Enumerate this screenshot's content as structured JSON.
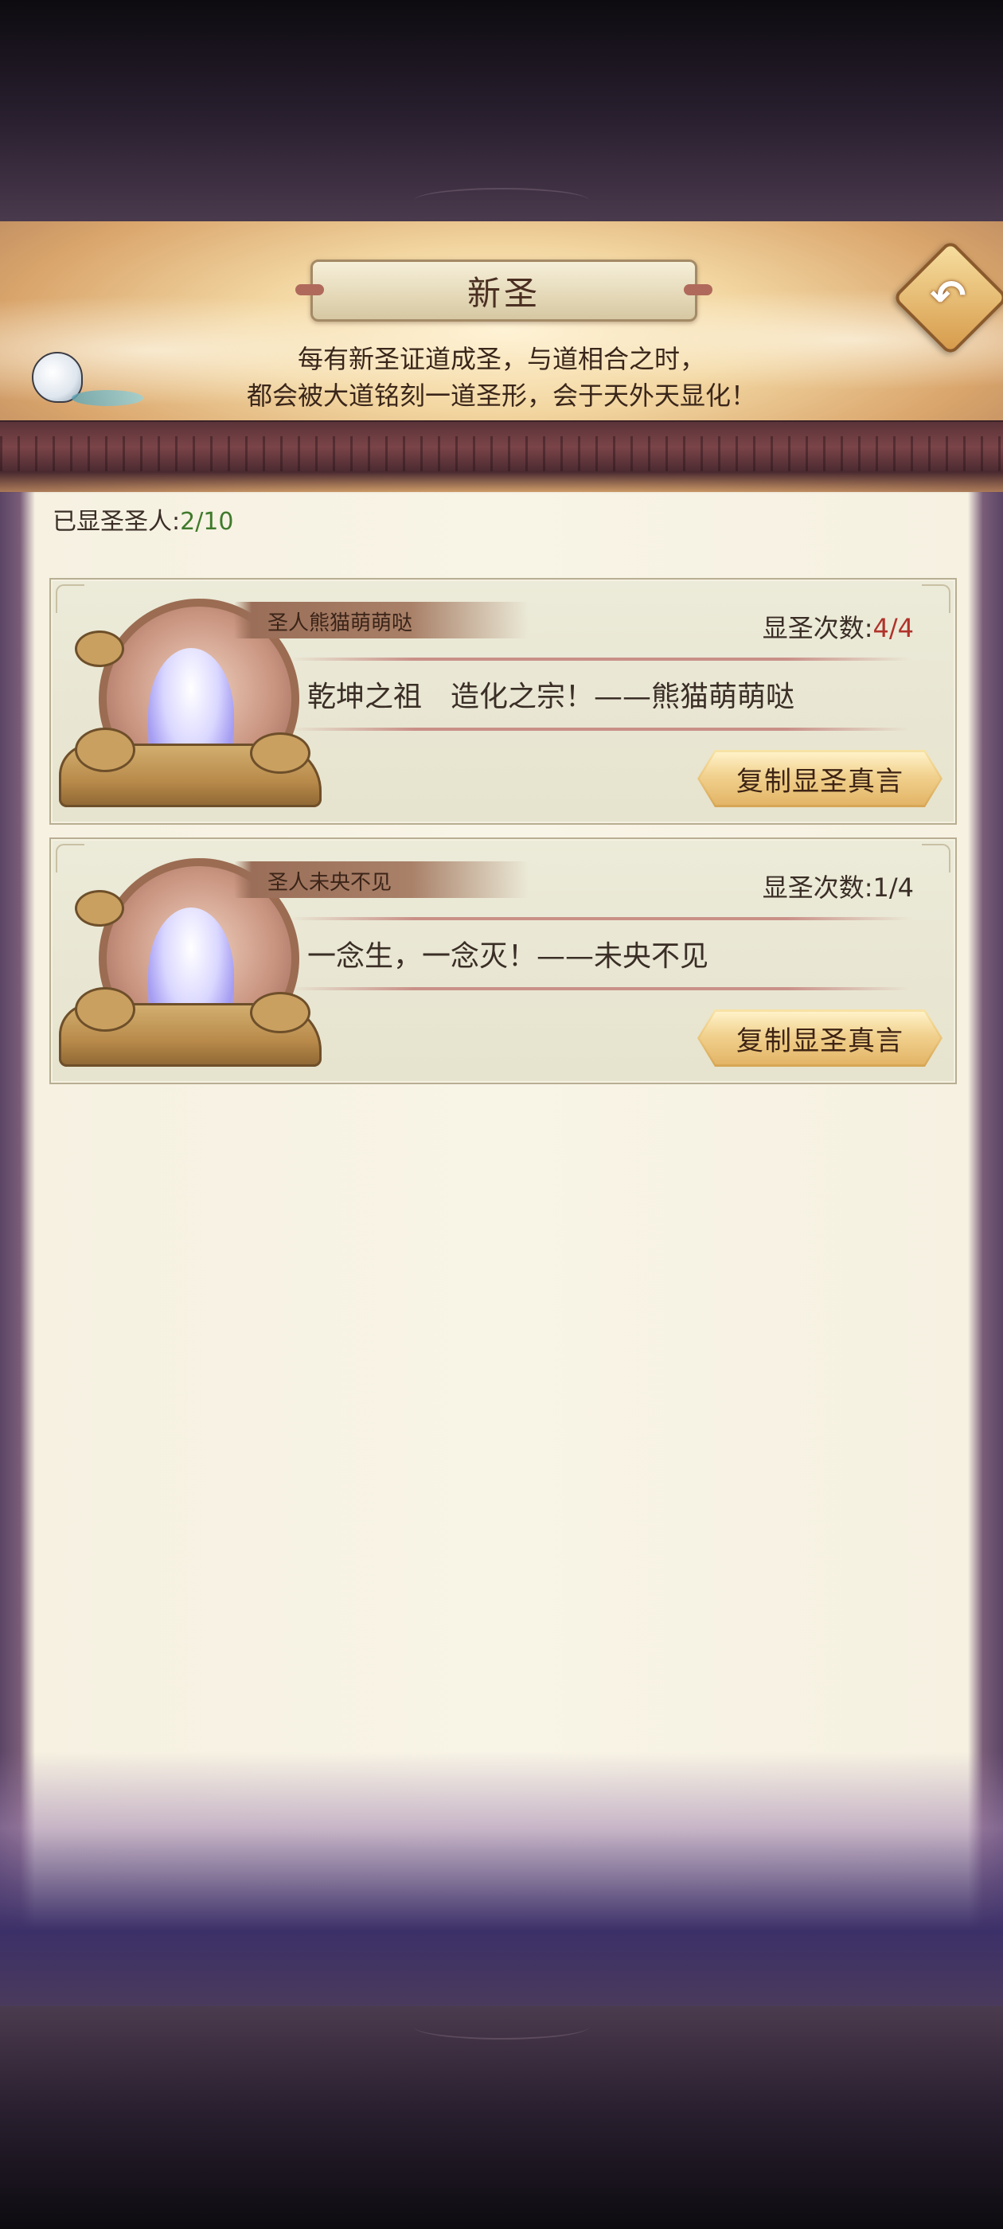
{
  "header": {
    "title": "新圣",
    "subtitle_line1": "每有新圣证道成圣，与道相合之时，",
    "subtitle_line2": "都会被大道铭刻一道圣形，会于天外天显化！"
  },
  "count": {
    "label": "已显圣圣人:",
    "value": "2/10"
  },
  "saints": [
    {
      "name": "圣人熊猫萌萌哒",
      "times_label": "显圣次数:",
      "times_value": "4/4",
      "quote": "乾坤之祖　造化之宗！——熊猫萌萌哒",
      "button": "复制显圣真言"
    },
    {
      "name": "圣人未央不见",
      "times_label": "显圣次数:",
      "times_value": "1/4",
      "quote": "一念生，一念灭！——未央不见",
      "button": "复制显圣真言"
    }
  ],
  "colors": {
    "count_value": "#3f7a2c",
    "times_full": "#b0332a",
    "button": "#eac57a"
  },
  "icons": {
    "back": "back-arrow-icon",
    "bird": "bird-decoration-icon"
  }
}
